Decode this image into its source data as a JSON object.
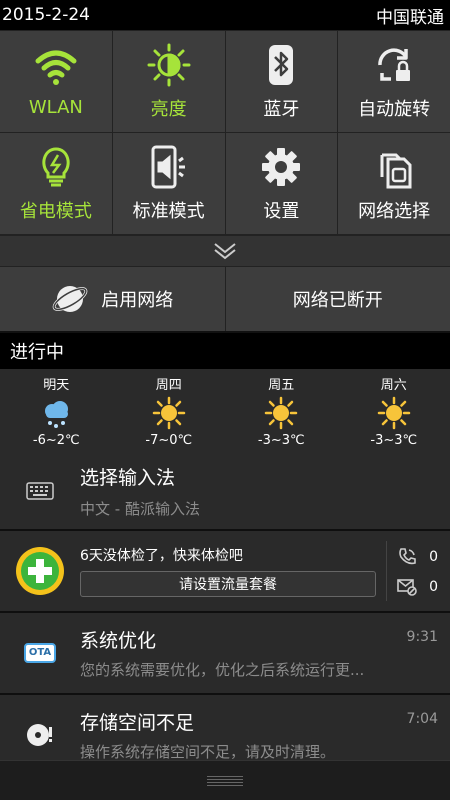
{
  "status_bar": {
    "date": "2015-2-24",
    "carrier": "中国联通"
  },
  "quick_settings": {
    "tiles": [
      {
        "label": "WLAN",
        "icon": "wifi-icon",
        "active": true
      },
      {
        "label": "亮度",
        "icon": "brightness-icon",
        "active": true
      },
      {
        "label": "蓝牙",
        "icon": "bluetooth-icon",
        "active": false
      },
      {
        "label": "自动旋转",
        "icon": "rotate-lock-icon",
        "active": false
      },
      {
        "label": "省电模式",
        "icon": "bulb-icon",
        "active": true
      },
      {
        "label": "标准模式",
        "icon": "phone-sound-icon",
        "active": false
      },
      {
        "label": "设置",
        "icon": "gear-icon",
        "active": false
      },
      {
        "label": "网络选择",
        "icon": "sim-card-icon",
        "active": false
      }
    ],
    "accent_color": "#a6e33a",
    "enable_network_label": "启用网络",
    "network_status_label": "网络已断开"
  },
  "ongoing_header": "进行中",
  "weather": [
    {
      "day": "明天",
      "icon": "snow-cloud-icon",
      "temp": "-6~2℃"
    },
    {
      "day": "周四",
      "icon": "sun-icon",
      "temp": "-7~0℃"
    },
    {
      "day": "周五",
      "icon": "sun-icon",
      "temp": "-3~3℃"
    },
    {
      "day": "周六",
      "icon": "sun-icon",
      "temp": "-3~3℃"
    }
  ],
  "input_method": {
    "title": "选择输入法",
    "subtitle": "中文 - 酷派输入法"
  },
  "security_360": {
    "message": "6天没体检了，快来体检吧",
    "button": "请设置流量套餐",
    "call_count": "0",
    "sms_count": "0"
  },
  "notifications": [
    {
      "title": "系统优化",
      "text": "您的系统需要优化，优化之后系统运行更...",
      "time": "9:31",
      "icon": "ota-icon"
    },
    {
      "title": "存储空间不足",
      "text": "操作系统存储空间不足，请及时清理。",
      "time": "7:04",
      "icon": "storage-warning-icon"
    }
  ],
  "ota_badge": "OTA"
}
